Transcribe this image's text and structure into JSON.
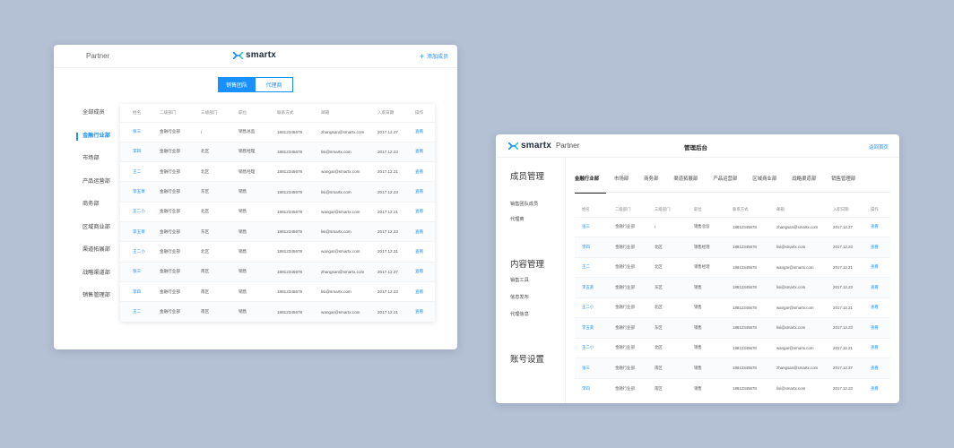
{
  "win1": {
    "partner": "Partner",
    "brand": "smartx",
    "add_member": "添加成员",
    "seg": [
      "销售团队",
      "代理商"
    ],
    "sidebar": [
      "全部成员",
      "金融行业部",
      "市场部",
      "产品运营部",
      "商务部",
      "区域商业部",
      "渠道拓展部",
      "战略渠道部",
      "销售管理部"
    ],
    "columns": [
      "姓名",
      "二级部门",
      "三级部门",
      "职位",
      "联系方式",
      "邮箱",
      "入职日期",
      "操作"
    ],
    "rows": [
      [
        "张三",
        "金融行业部",
        "/",
        "销售总监",
        "18812345678",
        "zhangsan@smartx.com",
        "2017.12.27",
        "查看"
      ],
      [
        "李四",
        "金融行业部",
        "北区",
        "销售经理",
        "18812345678",
        "lisi@smartx.com",
        "2017.12.23",
        "查看"
      ],
      [
        "王二",
        "金融行业部",
        "北区",
        "销售经理",
        "18812345678",
        "wangar@smartx.com",
        "2017.12.21",
        "查看"
      ],
      [
        "李五莱",
        "金融行业部",
        "东区",
        "销售",
        "18812345678",
        "lisi@smartx.com",
        "2017.12.23",
        "查看"
      ],
      [
        "王二小",
        "金融行业部",
        "北区",
        "销售",
        "18812345678",
        "wangar@smartx.com",
        "2017.12.21",
        "查看"
      ],
      [
        "李五莱",
        "金融行业部",
        "东区",
        "销售",
        "18812345678",
        "lisi@smartx.com",
        "2017.12.23",
        "查看"
      ],
      [
        "王二小",
        "金融行业部",
        "北区",
        "销售",
        "18812345678",
        "wangar@smartx.com",
        "2017.12.21",
        "查看"
      ],
      [
        "张三",
        "金融行业部",
        "南区",
        "销售",
        "18812345678",
        "zhangsan@smartx.com",
        "2017.12.27",
        "查看"
      ],
      [
        "李四",
        "金融行业部",
        "南区",
        "销售",
        "18812345678",
        "lisi@smartx.com",
        "2017.12.23",
        "查看"
      ],
      [
        "王二",
        "金融行业部",
        "南区",
        "销售",
        "18812345678",
        "wangar@smartx.com",
        "2017.12.21",
        "查看"
      ]
    ]
  },
  "win2": {
    "brand": "smartx",
    "partner": "Partner",
    "title": "管理后台",
    "back": "返回首页",
    "sections": [
      {
        "title": "成员管理",
        "items": [
          "销售团队成员",
          "代理商"
        ]
      },
      {
        "title": "内容管理",
        "items": [
          "销售工具",
          "信息发布",
          "代理信息"
        ]
      },
      {
        "title": "账号设置",
        "items": []
      }
    ],
    "tabs": [
      "金融行业部",
      "市场部",
      "商务部",
      "渠道拓展部",
      "产品运营部",
      "区域商业部",
      "战略渠道部",
      "销售管理部"
    ],
    "columns": [
      "姓名",
      "二级部门",
      "三级部门",
      "职位",
      "联系方式",
      "邮箱",
      "入职日期",
      "操作"
    ],
    "rows": [
      [
        "张三",
        "金融行业部",
        "/",
        "销售总监",
        "18812345678",
        "zhangsan@smartx.com",
        "2017.12.27",
        "查看"
      ],
      [
        "李四",
        "金融行业部",
        "北区",
        "销售经理",
        "18812345678",
        "lisi@smartx.com",
        "2017.12.23",
        "查看"
      ],
      [
        "王二",
        "金融行业部",
        "北区",
        "销售经理",
        "18812345678",
        "wangar@smartx.com",
        "2017.12.21",
        "查看"
      ],
      [
        "李五莱",
        "金融行业部",
        "东区",
        "销售",
        "18812345678",
        "lisi@smartx.com",
        "2017.12.23",
        "查看"
      ],
      [
        "王二小",
        "金融行业部",
        "北区",
        "销售",
        "18812345678",
        "wangar@smartx.com",
        "2017.12.21",
        "查看"
      ],
      [
        "李五莱",
        "金融行业部",
        "东区",
        "销售",
        "18812345678",
        "lisi@smartx.com",
        "2017.12.23",
        "查看"
      ],
      [
        "王二小",
        "金融行业部",
        "北区",
        "销售",
        "18812345678",
        "wangar@smartx.com",
        "2017.12.21",
        "查看"
      ],
      [
        "张三",
        "金融行业部",
        "南区",
        "销售",
        "18812345678",
        "zhangsan@smartx.com",
        "2017.12.27",
        "查看"
      ],
      [
        "李四",
        "金融行业部",
        "南区",
        "销售",
        "18812345678",
        "lisi@smartx.com",
        "2017.12.23",
        "查看"
      ]
    ]
  },
  "colors": {
    "accent": "#1890ff",
    "logo_blue": "#1890ff",
    "logo_green": "#36cfc9",
    "background": "#b4c0d4"
  }
}
